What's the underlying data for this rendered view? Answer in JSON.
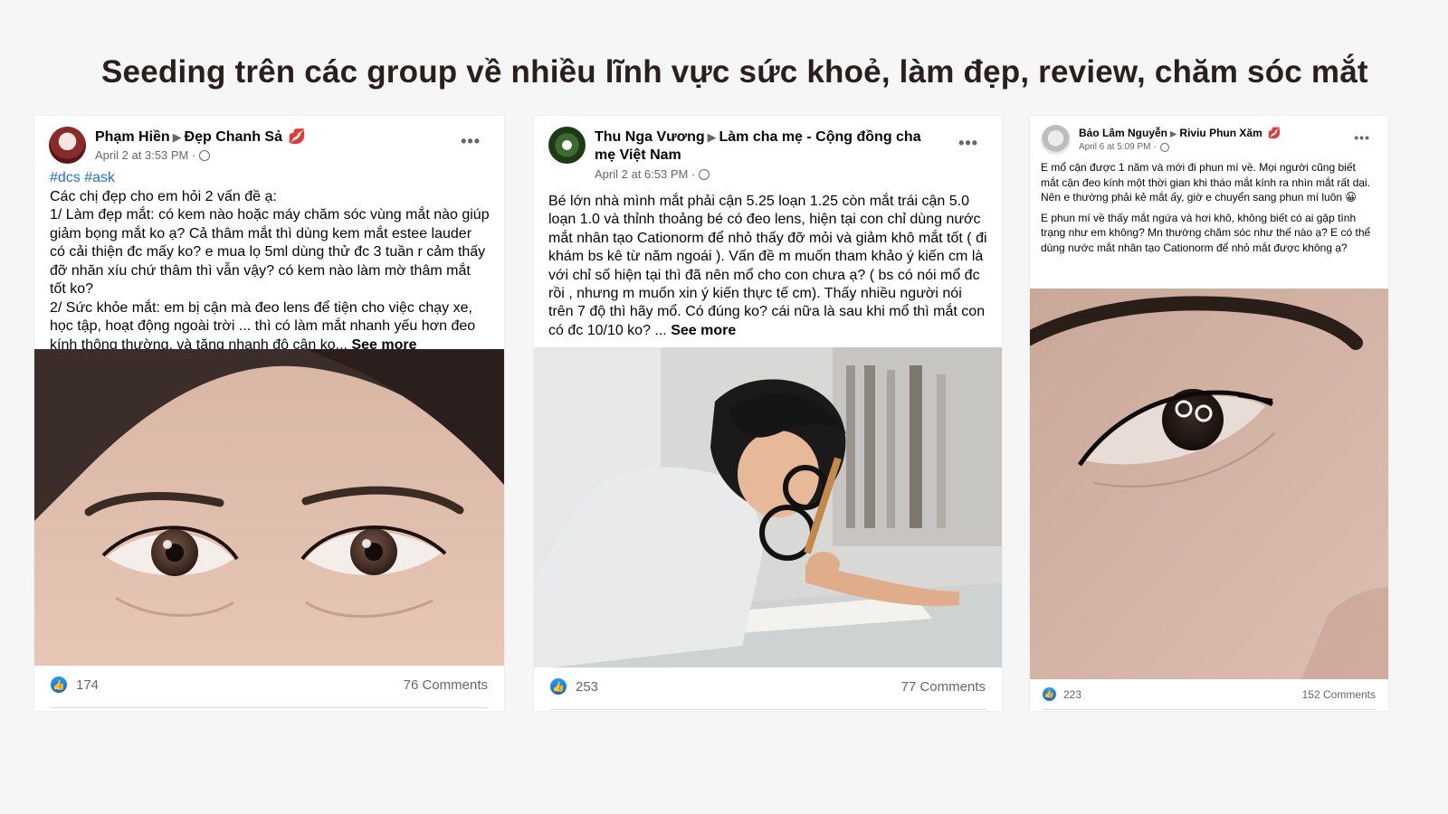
{
  "page": {
    "title": "Seeding trên các group về nhiều lĩnh vực sức khoẻ, làm đẹp, review, chăm sóc mắt"
  },
  "colors": {
    "background": "#f6f6f6",
    "link_blue": "#216fdb",
    "like_blue": "#1877f2",
    "meta_gray": "#65676b"
  },
  "posts": [
    {
      "author": "Phạm Hiền",
      "group": "Đẹp Chanh Sả",
      "group_icon": "lips-icon",
      "timestamp": "April 2 at 3:53 PM ·",
      "hashtags": "#dcs #ask",
      "text": "Các chị đẹp cho em hỏi 2 vấn đề ạ:\n1/ Làm đẹp mắt: có kem nào hoặc máy chăm sóc vùng mắt nào giúp giảm bọng mắt ko ạ? Cả thâm mắt thì dùng kem mắt estee lauder có cải thiện đc mấy ko? e mua lọ 5ml dùng thử đc 3 tuần r cảm thấy đỡ nhăn xíu chứ thâm thì vẫn vậy? có kem nào làm mờ thâm mắt tốt ko?\n2/ Sức khỏe mắt: em bị cận mà đeo lens để tiện cho việc chạy xe, học tập, hoạt động ngoài trời ... thì có làm mắt nhanh yếu hơn đeo kính thông thường, và tăng nhanh độ cận ko...",
      "see_more": "See more",
      "photo": "close-up-woman-eyes-photo",
      "likes": "174",
      "comments": "76 Comments"
    },
    {
      "author": "Thu Nga Vương",
      "group": "Làm cha mẹ - Cộng đồng cha mẹ Việt Nam",
      "group_icon": "",
      "timestamp": "April 2 at 6:53 PM ·",
      "hashtags": "",
      "text": "Bé lớn nhà mình mắt phải cận 5.25 loạn 1.25 còn mắt trái cận 5.0 loạn 1.0 và thỉnh thoảng bé có đeo lens, hiện tại con chỉ dùng nước mắt nhân tạo Cationorm để nhỏ thấy đỡ mỏi và giảm khô mắt tốt ( đi khám bs kê từ năm ngoái ). Vấn đề m muốn tham khảo ý kiến cm là với chỉ số hiện tại thì đã nên mổ cho con chưa ạ? ( bs có nói mổ đc rồi , nhưng m muốn xin ý kiến thực tế cm). Thấy nhiều người nói trên 7 độ thì hãy mổ. Có đúng ko? cái nữa là sau khi mổ thì mắt con có đc 10/10 ko? ...",
      "see_more": "See more",
      "photo": "child-with-glasses-writing-photo",
      "likes": "253",
      "comments": "77 Comments"
    },
    {
      "author": "Bảo Lâm Nguyễn",
      "group": "Riviu Phun Xăm",
      "group_icon": "lips-icon",
      "timestamp": "April 6 at 5:09 PM ·",
      "hashtags": "",
      "text": "E mổ cận được 1 năm và mới đi phun mí về. Mọi người cũng biết mắt cận đeo kính một thời gian khi tháo mắt kính ra nhìn mắt rất dại. Nên e thường phải kẻ mắt ấy, giờ e chuyển sang phun mí luôn 😀",
      "text2": "E phun mí về thấy mắt ngứa và hơi khô, không biết có ai gặp tình trạng như em không? Mn thường chăm sóc như thế nào ạ? E có thể dùng nước mắt nhân tạo Cationorm để nhỏ mắt được không ạ?",
      "photo": "close-up-eye-eyeliner-photo",
      "likes": "223",
      "comments": "152 Comments"
    }
  ]
}
